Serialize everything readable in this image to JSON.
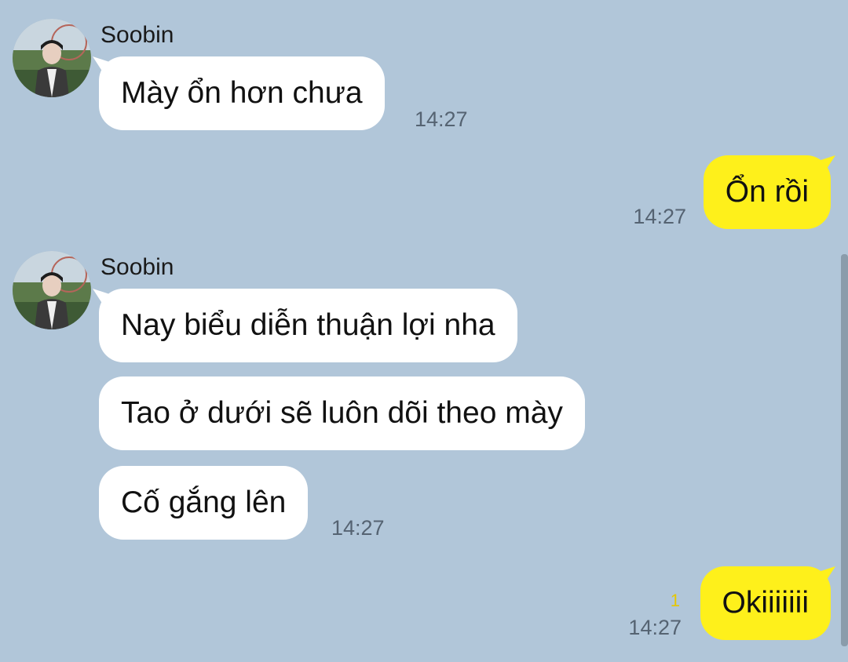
{
  "messages": [
    {
      "sender": "Soobin",
      "text": "Mày ổn hơn chưa",
      "time": "14:27"
    },
    {
      "text": "Ổn rồi",
      "time": "14:27"
    },
    {
      "sender": "Soobin",
      "text": "Nay biểu diễn thuận lợi nha"
    },
    {
      "text": "Tao ở dưới sẽ luôn dõi theo mày"
    },
    {
      "text": "Cố gắng lên",
      "time": "14:27"
    },
    {
      "text": "Okiiiiiii",
      "time": "14:27",
      "unread_count": "1"
    }
  ],
  "colors": {
    "background": "#b1c6d9",
    "incoming_bubble": "#ffffff",
    "outgoing_bubble": "#fef01b",
    "timestamp": "#556372",
    "unread_counter": "#e6c700"
  },
  "icons": {
    "avatar": "contact-avatar-photo"
  }
}
